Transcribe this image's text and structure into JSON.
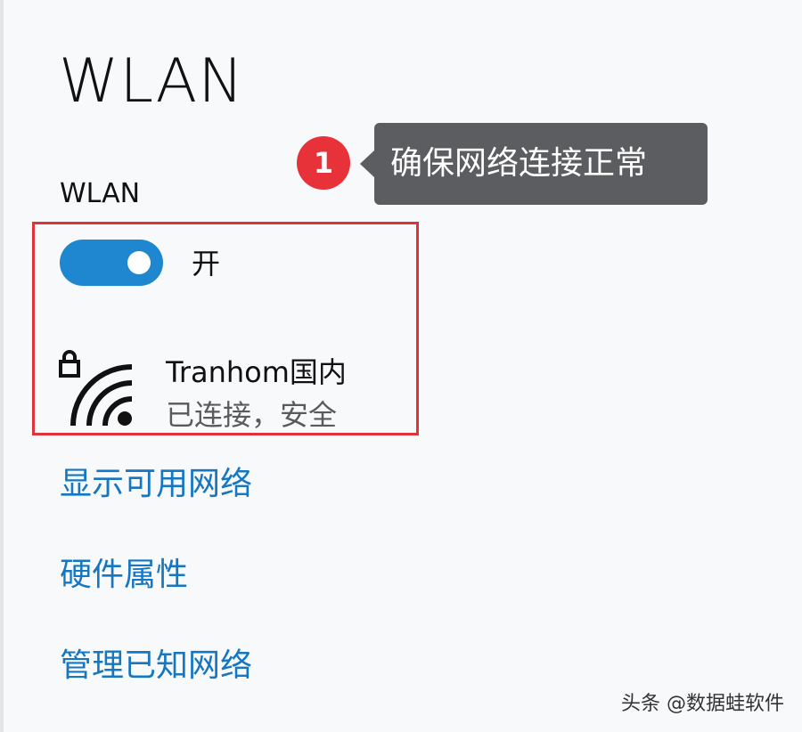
{
  "page": {
    "title": "WLAN",
    "section_label": "WLAN"
  },
  "annotation": {
    "badge_number": "1",
    "tooltip_text": "确保网络连接正常",
    "badge_color": "#e8323a",
    "box_color": "#e0323a"
  },
  "wifi": {
    "toggle_on": true,
    "toggle_label": "开",
    "accent_color": "#1f87cf",
    "network": {
      "icon": "wifi-secured-icon",
      "name": "Tranhom国内",
      "status": "已连接，安全"
    }
  },
  "links": {
    "show_networks": "显示可用网络",
    "hardware_properties": "硬件属性",
    "manage_known": "管理已知网络",
    "color": "#1576c2"
  },
  "watermark": {
    "text": "头条 @数据蛙软件"
  }
}
